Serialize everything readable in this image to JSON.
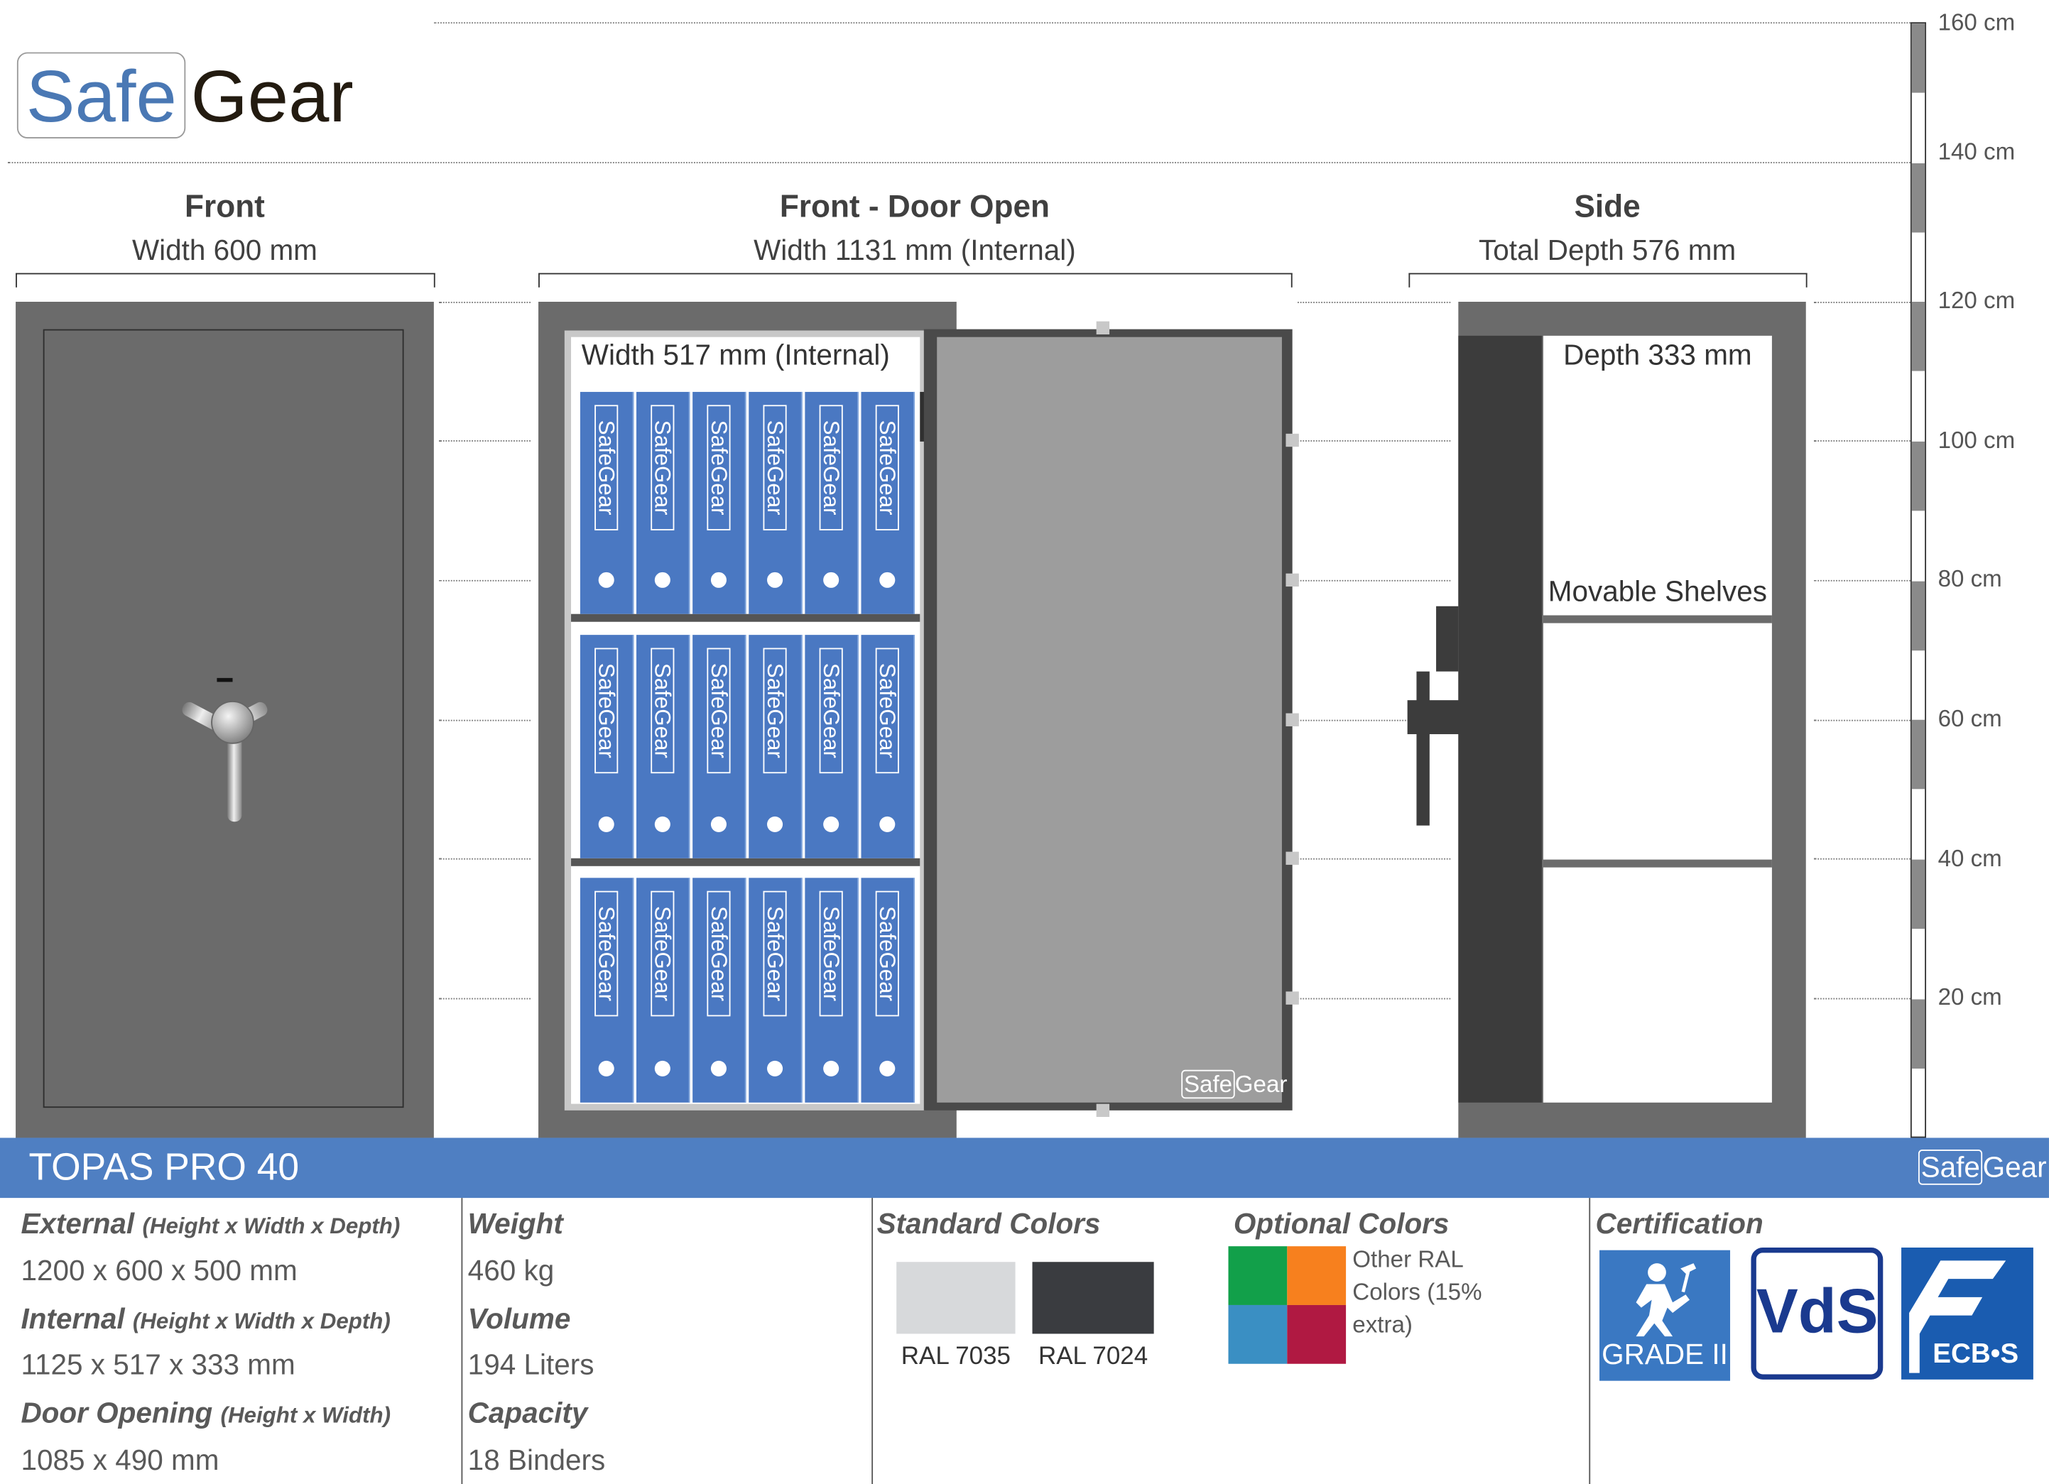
{
  "brand": {
    "logo_part1": "Safe",
    "logo_part2": "Gear"
  },
  "views": {
    "front": {
      "title": "Front",
      "subtitle": "Width 600 mm"
    },
    "door_open": {
      "title": "Front - Door Open",
      "subtitle": "Width 1131 mm (Internal)",
      "inner_label": "Width 517 mm (Internal)"
    },
    "side": {
      "title": "Side",
      "subtitle": "Total Depth 576 mm",
      "depth_label": "Depth 333 mm",
      "shelves_label": "Movable Shelves"
    }
  },
  "binder_label": "SafeGear",
  "door_logo": {
    "part1": "Safe",
    "part2": "Gear"
  },
  "scale": {
    "ticks": [
      "160 cm",
      "140 cm",
      "120 cm",
      "100 cm",
      "80 cm",
      "60 cm",
      "40 cm",
      "20 cm"
    ]
  },
  "product": {
    "name": "TOPAS PRO 40",
    "banner_logo": {
      "part1": "Safe",
      "part2": "Gear"
    },
    "external_label": "External",
    "external_dims_note": "(Height x Width x Depth)",
    "external_value": "1200 x 600 x 500 mm",
    "internal_label": "Internal",
    "internal_dims_note": "(Height x Width x Depth)",
    "internal_value": "1125 x 517 x 333 mm",
    "door_label": "Door Opening",
    "door_dims_note": "(Height x Width)",
    "door_value": "1085 x 490 mm",
    "weight_label": "Weight",
    "weight_value": "460 kg",
    "volume_label": "Volume",
    "volume_value": "194 Liters",
    "capacity_label": "Capacity",
    "capacity_value": "18 Binders"
  },
  "colors": {
    "standard_title": "Standard Colors",
    "standard": [
      {
        "name": "RAL 7035",
        "hex": "#d7d9db"
      },
      {
        "name": "RAL 7024",
        "hex": "#3a3c40"
      }
    ],
    "optional_title": "Optional Colors",
    "optional_hexes": [
      "#12a04a",
      "#f7801e",
      "#3a8fc3",
      "#b01942"
    ],
    "optional_note_line1": "Other RAL",
    "optional_note_line2": "Colors (15%",
    "optional_note_line3": "extra)"
  },
  "certification": {
    "title": "Certification",
    "badges": [
      {
        "icon": "grade-ii-icon",
        "text": "GRADE II"
      },
      {
        "icon": "vds-icon",
        "text": "VdS"
      },
      {
        "icon": "ecbs-icon",
        "text": "ECB•S"
      }
    ]
  },
  "palette": {
    "safe_body": "#6b6b6b",
    "binder_blue": "#4a78c2",
    "banner_blue": "#4f7fc2"
  }
}
